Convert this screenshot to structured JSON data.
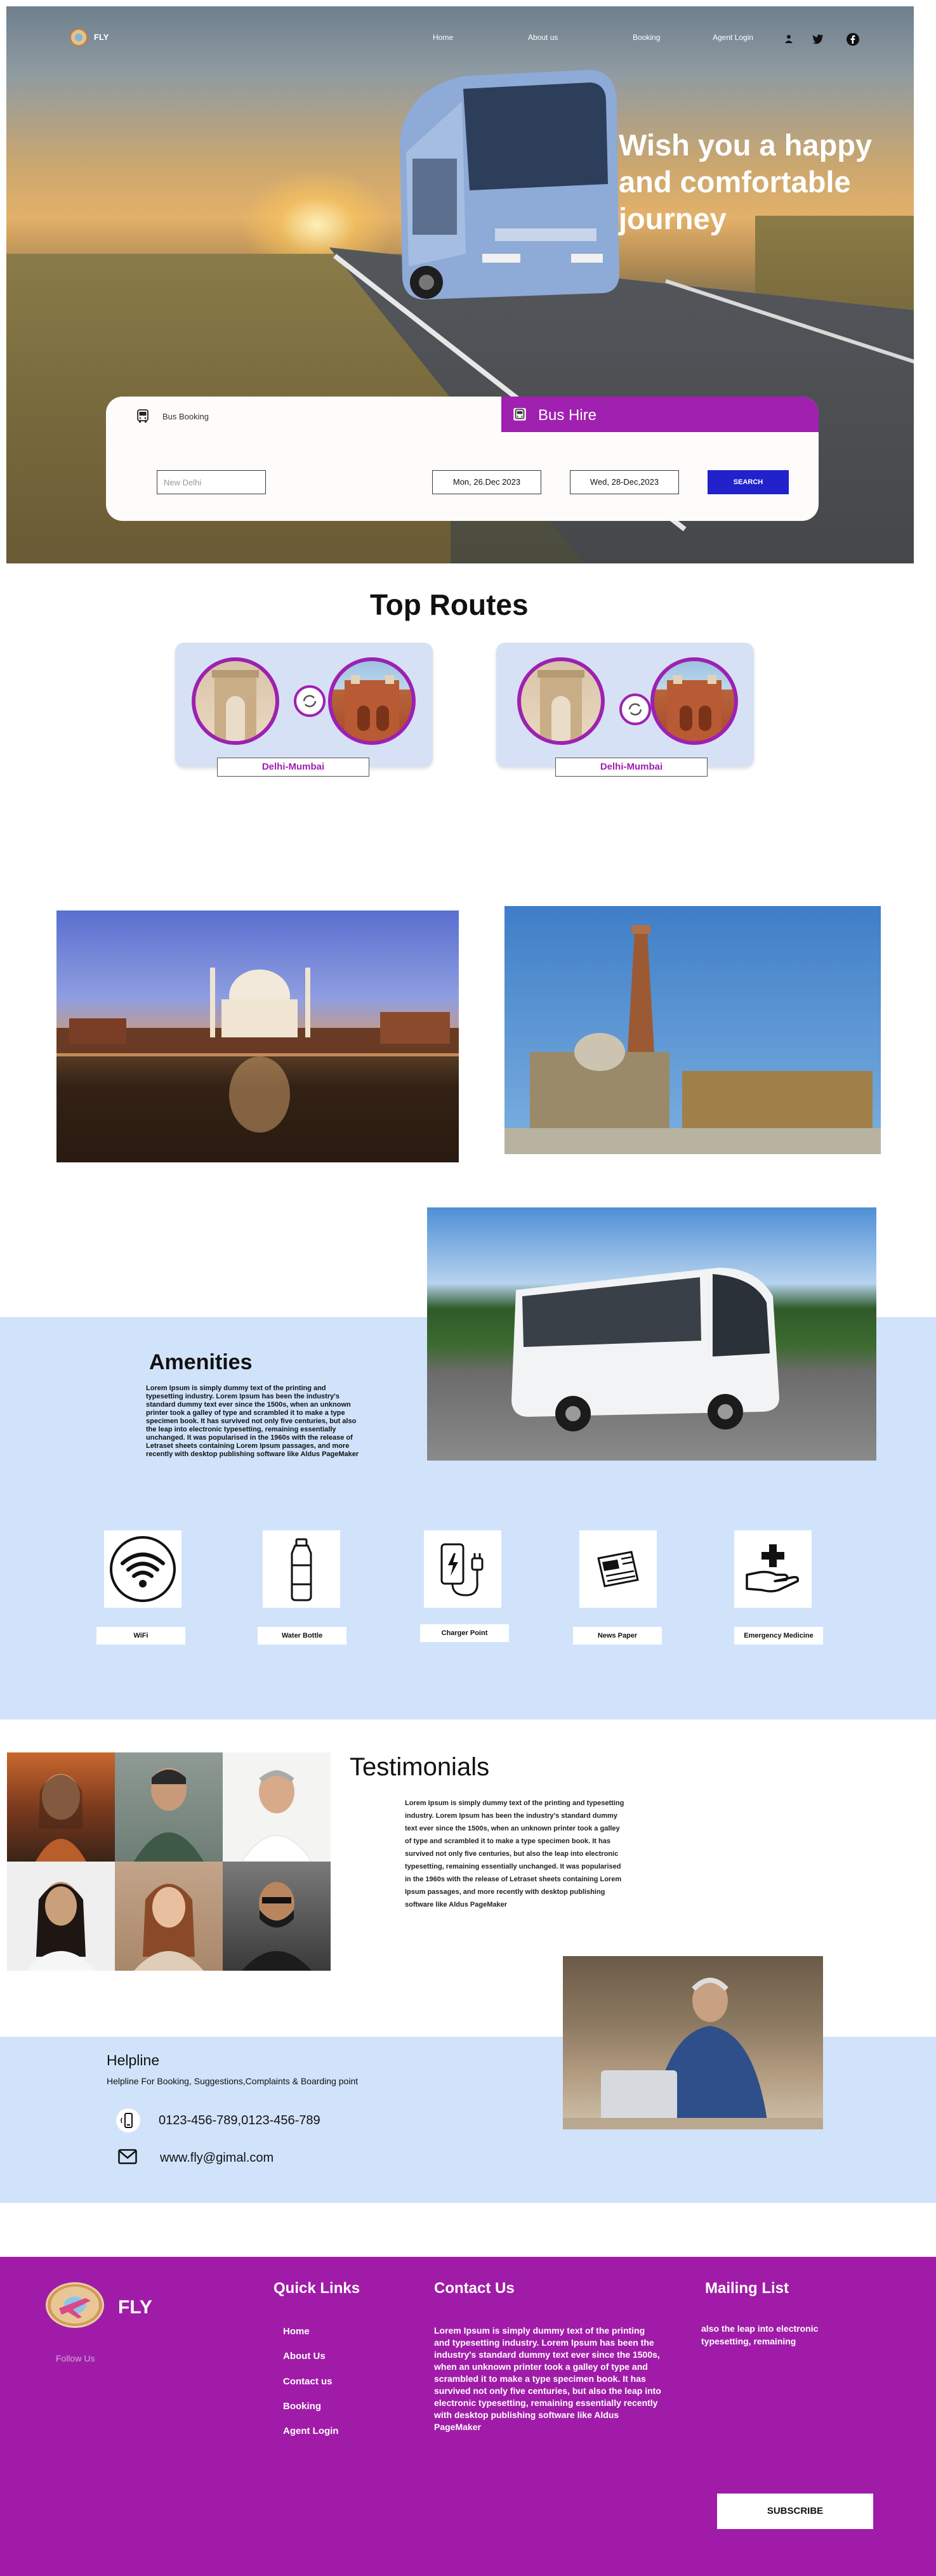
{
  "nav": {
    "brand": "FLY",
    "links": [
      "Home",
      "About us",
      "Booking",
      "Agent Login"
    ],
    "icons": [
      "user-icon",
      "twitter-icon",
      "facebook-icon"
    ]
  },
  "hero": {
    "heading": "Wish you a happy and comfortable journey"
  },
  "booking": {
    "tabs": [
      {
        "label": "Bus Booking",
        "icon": "bus-icon",
        "active": false
      },
      {
        "label": "Bus Hire",
        "icon": "bus-icon",
        "active": true
      }
    ],
    "from_placeholder": "New Delhi",
    "depart_date": "Mon, 26.Dec 2023",
    "return_date": "Wed, 28-Dec,2023",
    "search_label": "SEARCH"
  },
  "routes": {
    "title": "Top Routes",
    "items": [
      {
        "label": "Delhi-Mumbai"
      },
      {
        "label": "Delhi-Mumbai"
      }
    ]
  },
  "amenities": {
    "title": "Amenities",
    "description": "Lorem Ipsum is simply dummy text of the printing and typesetting industry. Lorem Ipsum has been the industry's standard dummy text ever since the 1500s, when an unknown printer took a galley of type and scrambled it to make a type specimen book. It has survived not only five centuries, but also the leap into electronic typesetting, remaining essentially unchanged. It was popularised in the 1960s with the release of Letraset sheets containing Lorem Ipsum passages, and more recently with desktop publishing software like Aldus PageMaker",
    "items": [
      {
        "label": "WiFi",
        "icon": "wifi-icon"
      },
      {
        "label": "Water Bottle",
        "icon": "water-bottle-icon"
      },
      {
        "label": "Charger  Point",
        "icon": "charger-icon"
      },
      {
        "label": "News Paper",
        "icon": "newspaper-icon"
      },
      {
        "label": "Emergency Medicine",
        "icon": "medicine-icon"
      }
    ]
  },
  "testimonials": {
    "title": "Testimonials",
    "text": "Lorem Ipsum is simply dummy text of the printing and typesetting industry. Lorem Ipsum has been the industry's standard dummy text ever since the 1500s, when an unknown printer took a galley of type and scrambled it to make a type specimen book. It has survived not only five centuries, but also the leap into electronic typesetting, remaining essentially unchanged. It was popularised in the 1960s with the release of Letraset sheets containing Lorem Ipsum passages, and more recently with desktop publishing software like Aldus PageMaker"
  },
  "helpline": {
    "title": "Helpline",
    "subtitle": "Helpline For  Booking, Suggestions,Complaints & Boarding point",
    "phone": "0123-456-789,0123-456-789",
    "email": "www.fly@gimal.com"
  },
  "footer": {
    "brand": "FLY",
    "follow": "Follow Us",
    "quick_links_title": "Quick Links",
    "quick_links": [
      "Home",
      "About Us",
      "Contact us",
      "Booking",
      "Agent Login"
    ],
    "contact_title": "Contact Us",
    "contact_text": "Lorem Ipsum is simply dummy text of the printing and typesetting industry. Lorem Ipsum has been the industry's standard dummy text ever since the 1500s, when an unknown printer took a galley of type and scrambled it to make a type specimen book. It has survived not only five centuries, but also the leap into electronic typesetting, remaining essentially recently with desktop publishing software like Aldus PageMaker",
    "mailing_title": "Mailing List",
    "mailing_text": "also the leap into electronic typesetting, remaining",
    "subscribe_label": "SUBSCRIBE"
  },
  "colors": {
    "accent_purple": "#a020b0",
    "search_blue": "#2222cc",
    "band_blue": "#d1e3fb",
    "footer_purple": "#a01ca8"
  }
}
